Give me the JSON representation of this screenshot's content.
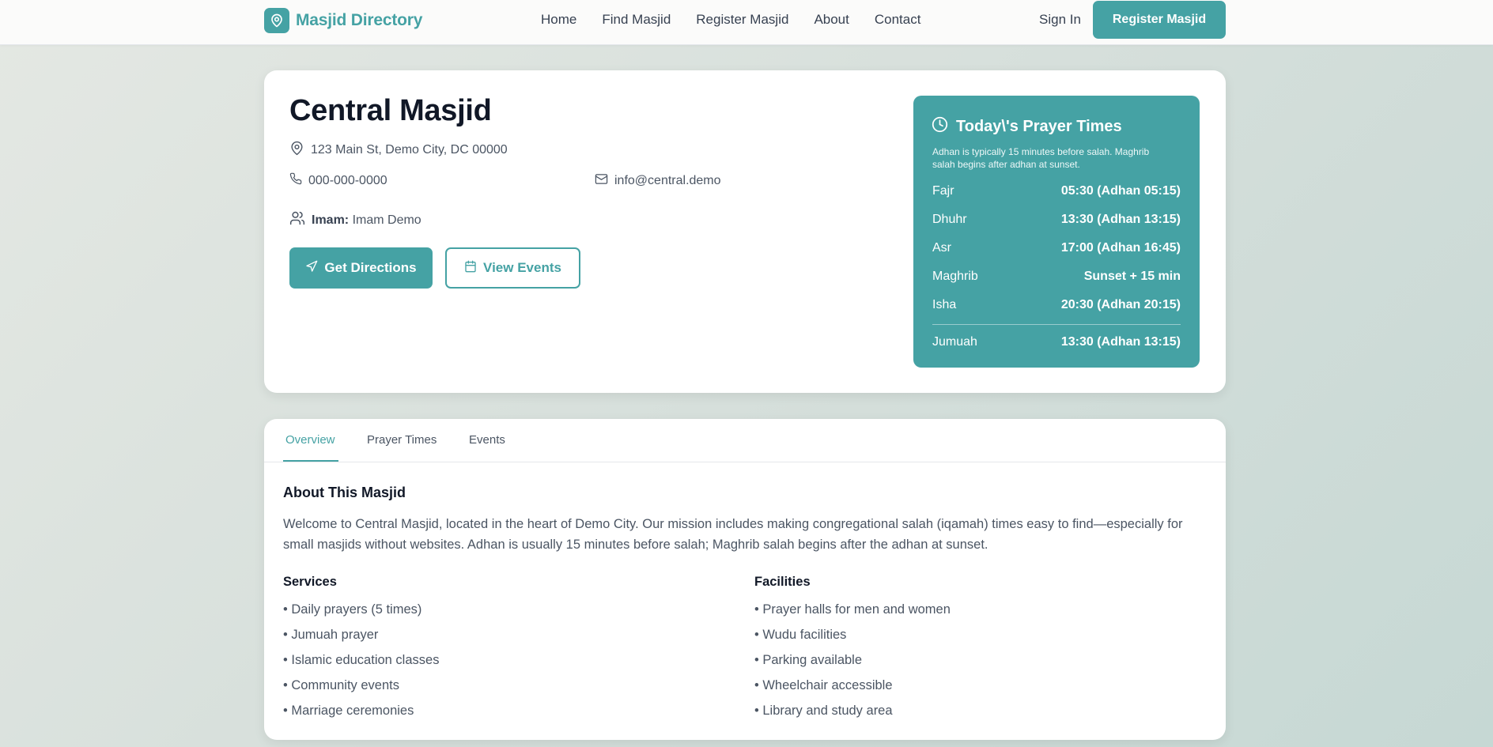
{
  "nav": {
    "brand": "Masjid Directory",
    "links": [
      "Home",
      "Find Masjid",
      "Register Masjid",
      "About",
      "Contact"
    ],
    "sign_in": "Sign In",
    "register_button": "Register Masjid"
  },
  "masjid": {
    "name": "Central Masjid",
    "address": "123 Main St, Demo City, DC 00000",
    "phone": "000-000-0000",
    "email": "info@central.demo",
    "imam_label": "Imam:",
    "imam_name": "Imam Demo",
    "directions_button": "Get Directions",
    "events_button": "View Events"
  },
  "prayer": {
    "title": "Today\\'s Prayer Times",
    "note": "Adhan is typically 15 minutes before salah. Maghrib salah begins after adhan at sunset.",
    "times": [
      {
        "name": "Fajr",
        "time": "05:30 (Adhan 05:15)"
      },
      {
        "name": "Dhuhr",
        "time": "13:30 (Adhan 13:15)"
      },
      {
        "name": "Asr",
        "time": "17:00 (Adhan 16:45)"
      },
      {
        "name": "Maghrib",
        "time": "Sunset + 15 min"
      },
      {
        "name": "Isha",
        "time": "20:30 (Adhan 20:15)"
      }
    ],
    "jumuah": {
      "name": "Jumuah",
      "time": "13:30 (Adhan 13:15)"
    }
  },
  "tabs": {
    "items": [
      "Overview",
      "Prayer Times",
      "Events"
    ],
    "active": "Overview"
  },
  "overview": {
    "about_title": "About This Masjid",
    "about_text": "Welcome to Central Masjid, located in the heart of Demo City. Our mission includes making congregational salah (iqamah) times easy to find—especially for small masjids without websites. Adhan is usually 15 minutes before salah; Maghrib salah begins after the adhan at sunset.",
    "services_title": "Services",
    "services": [
      "• Daily prayers (5 times)",
      "• Jumuah prayer",
      "• Islamic education classes",
      "• Community events",
      "• Marriage ceremonies"
    ],
    "facilities_title": "Facilities",
    "facilities": [
      "• Prayer halls for men and women",
      "• Wudu facilities",
      "• Parking available",
      "• Wheelchair accessible",
      "• Library and study area"
    ]
  },
  "colors": {
    "accent": "#45a2a4",
    "heading": "#111827",
    "text": "#4b5563"
  },
  "icons": [
    "map-pin-icon",
    "phone-icon",
    "mail-icon",
    "users-icon",
    "navigation-icon",
    "calendar-icon",
    "clock-icon"
  ]
}
